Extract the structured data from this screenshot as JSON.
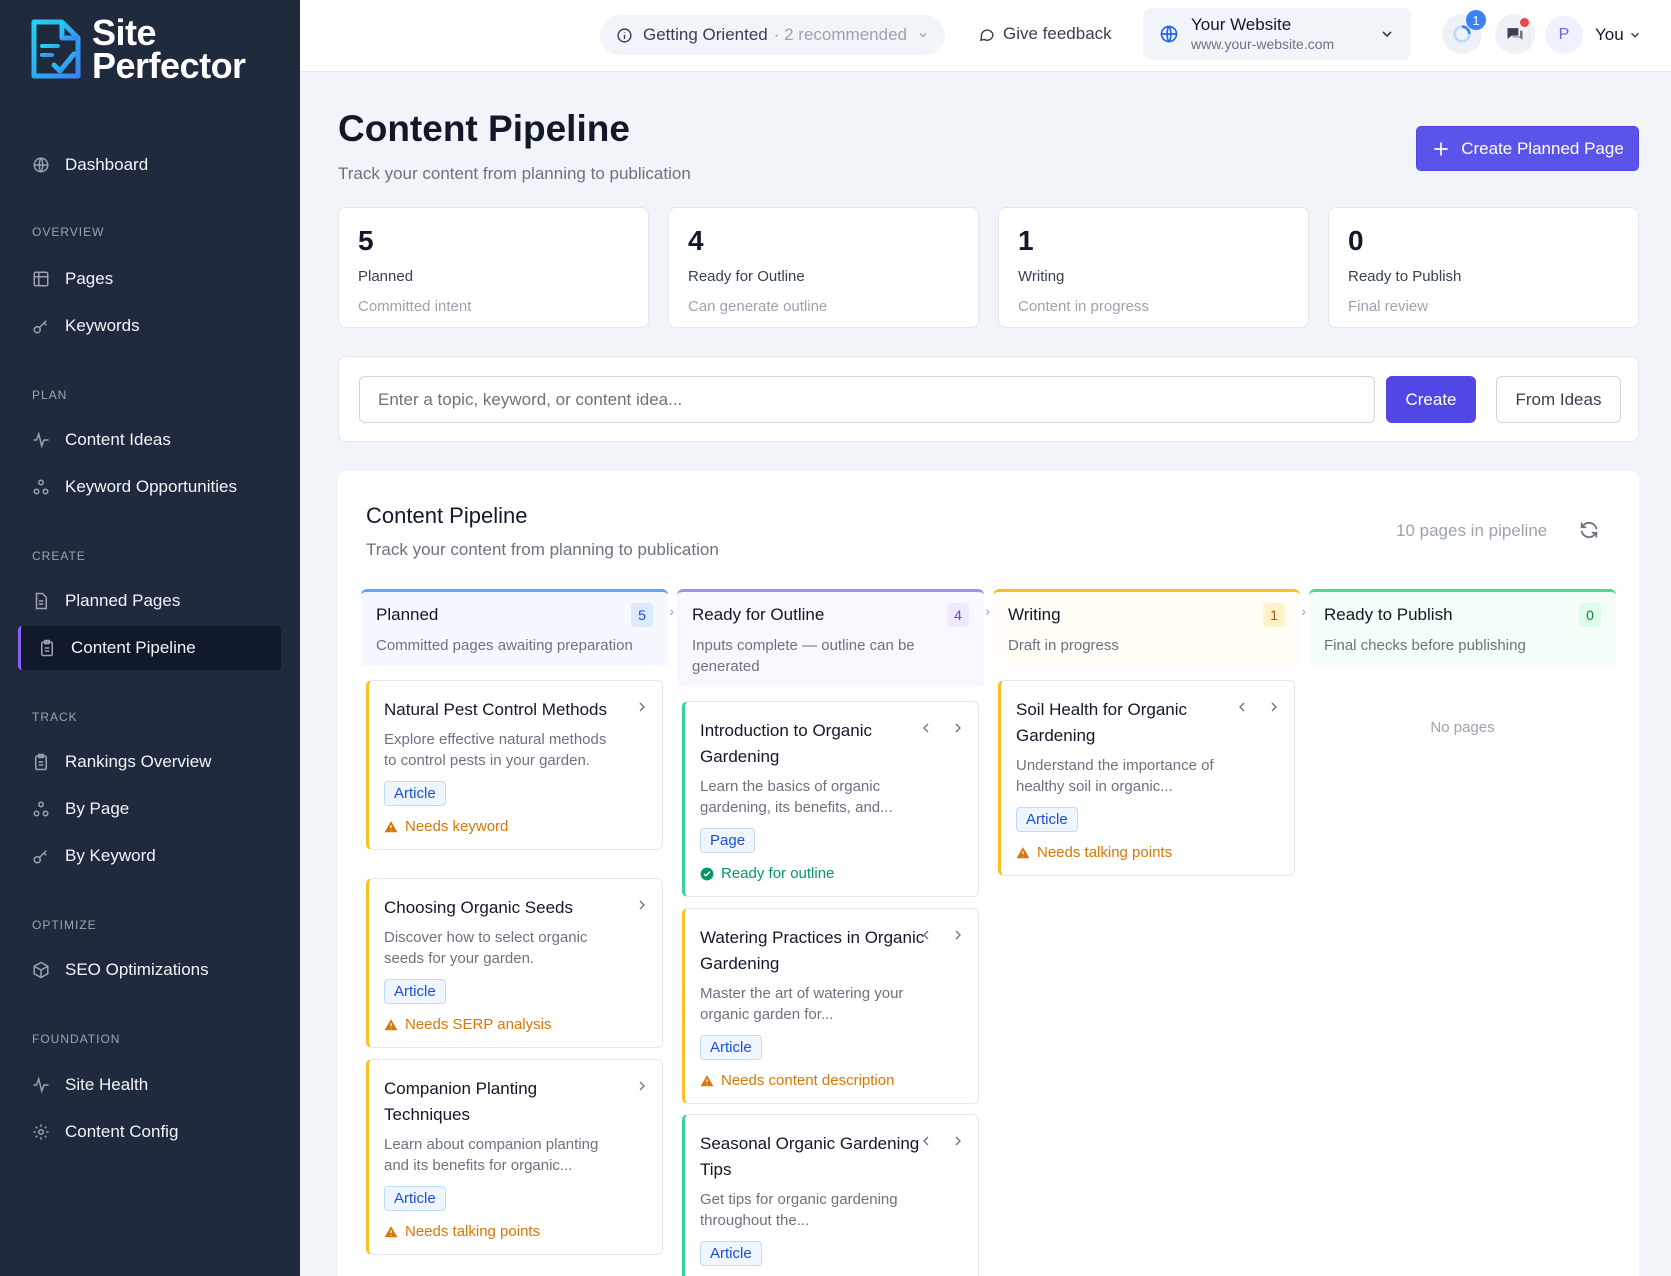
{
  "brand": {
    "line1": "Site",
    "line2": "Perfector"
  },
  "sidebar": {
    "dashboard": "Dashboard",
    "sections": {
      "overview": "OVERVIEW",
      "plan": "PLAN",
      "create": "CREATE",
      "track": "TRACK",
      "optimize": "OPTIMIZE",
      "foundation": "FOUNDATION"
    },
    "items": {
      "pages": "Pages",
      "keywords": "Keywords",
      "content_ideas": "Content Ideas",
      "keyword_opportunities": "Keyword Opportunities",
      "planned_pages": "Planned Pages",
      "content_pipeline": "Content Pipeline",
      "rankings_overview": "Rankings Overview",
      "by_page": "By Page",
      "by_keyword": "By Keyword",
      "seo_optimizations": "SEO Optimizations",
      "site_health": "Site Health",
      "content_config": "Content Config"
    },
    "active": "content_pipeline"
  },
  "topbar": {
    "orient_label": "Getting Oriented",
    "orient_count": "· 2 recommended",
    "feedback": "Give feedback",
    "site_name": "Your Website",
    "site_url": "www.your-website.com",
    "notif_count": "1",
    "avatar_letter": "P",
    "user_label": "You"
  },
  "header": {
    "title": "Content Pipeline",
    "subtitle": "Track your content from planning to publication",
    "create_button": "Create Planned Page"
  },
  "stats": [
    {
      "num": "5",
      "label": "Planned",
      "desc": "Committed intent"
    },
    {
      "num": "4",
      "label": "Ready for Outline",
      "desc": "Can generate outline"
    },
    {
      "num": "1",
      "label": "Writing",
      "desc": "Content in progress"
    },
    {
      "num": "0",
      "label": "Ready to Publish",
      "desc": "Final review"
    }
  ],
  "create_row": {
    "placeholder": "Enter a topic, keyword, or content idea...",
    "create": "Create",
    "from_ideas": "From Ideas"
  },
  "board": {
    "title": "Content Pipeline",
    "subtitle": "Track your content from planning to publication",
    "count_text": "10 pages in pipeline",
    "no_pages": "No pages",
    "columns": [
      {
        "title": "Planned",
        "count": "5",
        "desc": "Committed pages awaiting preparation",
        "color": "#60a5fa"
      },
      {
        "title": "Ready for Outline",
        "count": "4",
        "desc": "Inputs complete — outline can be generated",
        "color": "#a78bfa"
      },
      {
        "title": "Writing",
        "count": "1",
        "desc": "Draft in progress",
        "color": "#fbbf24"
      },
      {
        "title": "Ready to Publish",
        "count": "0",
        "desc": "Final checks before publishing",
        "color": "#4ade80"
      }
    ],
    "cards": {
      "planned": [
        {
          "title": "Natural Pest Control Methods",
          "desc": "Explore effective natural methods to control pests in your garden.",
          "tag": "Article",
          "status": "Needs keyword"
        },
        {
          "title": "Choosing Organic Seeds",
          "desc": "Discover how to select organic seeds for your garden.",
          "tag": "Article",
          "status": "Needs SERP analysis"
        },
        {
          "title": "Companion Planting Techniques",
          "desc": "Learn about companion planting and its benefits for organic...",
          "tag": "Article",
          "status": "Needs talking points"
        }
      ],
      "outline": [
        {
          "title": "Introduction to Organic Gardening",
          "desc": "Learn the basics of organic gardening, its benefits, and...",
          "tag": "Page",
          "status": "Ready for outline"
        },
        {
          "title": "Watering Practices in Organic Gardening",
          "desc": "Master the art of watering your organic garden for...",
          "tag": "Article",
          "status": "Needs content description"
        },
        {
          "title": "Seasonal Organic Gardening Tips",
          "desc": "Get tips for organic gardening throughout the...",
          "tag": "Article",
          "status": ""
        }
      ],
      "writing": [
        {
          "title": "Soil Health for Organic Gardening",
          "desc": "Understand the importance of healthy soil in organic...",
          "tag": "Article",
          "status": "Needs talking points"
        }
      ]
    }
  },
  "colors": {
    "accent": "#4f46e5",
    "sidebar_bg": "#1f2a3c",
    "warning": "#d97706",
    "success": "#059669"
  }
}
